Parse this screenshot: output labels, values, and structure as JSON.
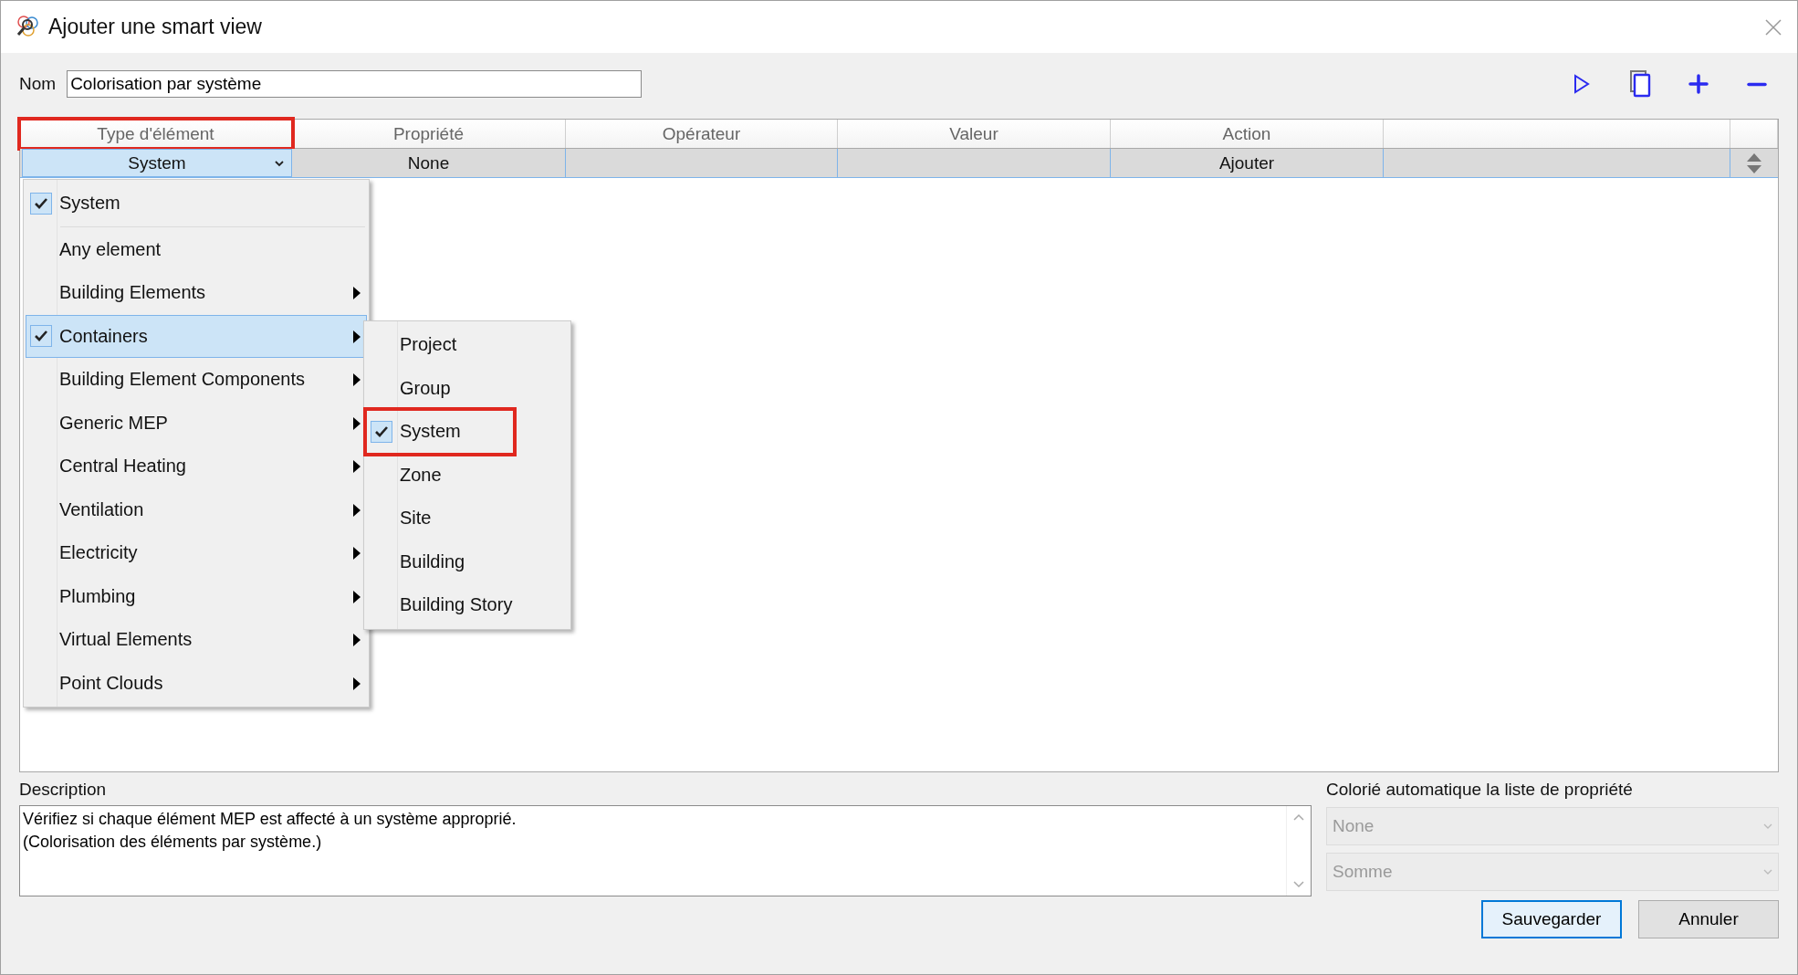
{
  "window": {
    "title": "Ajouter une smart view"
  },
  "name_field": {
    "label": "Nom",
    "value": "Colorisation par système"
  },
  "table": {
    "columns": [
      {
        "label": "Type d'élément",
        "highlighted": true
      },
      {
        "label": "Propriété",
        "highlighted": false
      },
      {
        "label": "Opérateur",
        "highlighted": false
      },
      {
        "label": "Valeur",
        "highlighted": false
      },
      {
        "label": "Action",
        "highlighted": false
      }
    ],
    "rows": [
      {
        "type": "System",
        "property": "None",
        "action": "Ajouter"
      }
    ]
  },
  "type_menu": {
    "items": [
      {
        "kind": "current",
        "label": "System",
        "checked": true,
        "has_submenu": false,
        "selected": false
      },
      {
        "kind": "item",
        "label": "Any element",
        "checked": false,
        "has_submenu": false,
        "selected": false
      },
      {
        "kind": "item",
        "label": "Building Elements",
        "checked": false,
        "has_submenu": true,
        "selected": false
      },
      {
        "kind": "item",
        "label": "Containers",
        "checked": true,
        "has_submenu": true,
        "selected": true
      },
      {
        "kind": "item",
        "label": "Building Element Components",
        "checked": false,
        "has_submenu": true,
        "selected": false
      },
      {
        "kind": "item",
        "label": "Generic MEP",
        "checked": false,
        "has_submenu": true,
        "selected": false
      },
      {
        "kind": "item",
        "label": "Central Heating",
        "checked": false,
        "has_submenu": true,
        "selected": false
      },
      {
        "kind": "item",
        "label": "Ventilation",
        "checked": false,
        "has_submenu": true,
        "selected": false
      },
      {
        "kind": "item",
        "label": "Electricity",
        "checked": false,
        "has_submenu": true,
        "selected": false
      },
      {
        "kind": "item",
        "label": "Plumbing",
        "checked": false,
        "has_submenu": true,
        "selected": false
      },
      {
        "kind": "item",
        "label": "Virtual Elements",
        "checked": false,
        "has_submenu": true,
        "selected": false
      },
      {
        "kind": "item",
        "label": "Point Clouds",
        "checked": false,
        "has_submenu": true,
        "selected": false
      }
    ]
  },
  "submenu": {
    "items": [
      {
        "label": "Project",
        "checked": false,
        "highlighted": false
      },
      {
        "label": "Group",
        "checked": false,
        "highlighted": false
      },
      {
        "label": "System",
        "checked": true,
        "highlighted": true
      },
      {
        "label": "Zone",
        "checked": false,
        "highlighted": false
      },
      {
        "label": "Site",
        "checked": false,
        "highlighted": false
      },
      {
        "label": "Building",
        "checked": false,
        "highlighted": false
      },
      {
        "label": "Building Story",
        "checked": false,
        "highlighted": false
      }
    ]
  },
  "description": {
    "label": "Description",
    "lines": [
      "Vérifiez si chaque élément MEP est affecté à un système approprié.",
      "(Colorisation des éléments par système.)"
    ]
  },
  "auto_color": {
    "label": "Colorié automatique la liste de propriété",
    "selects": [
      {
        "value": "None",
        "disabled": true
      },
      {
        "value": "Somme",
        "disabled": true
      }
    ]
  },
  "buttons": [
    {
      "label": "Sauvegarder",
      "default": true
    },
    {
      "label": "Annuler",
      "default": false
    }
  ]
}
